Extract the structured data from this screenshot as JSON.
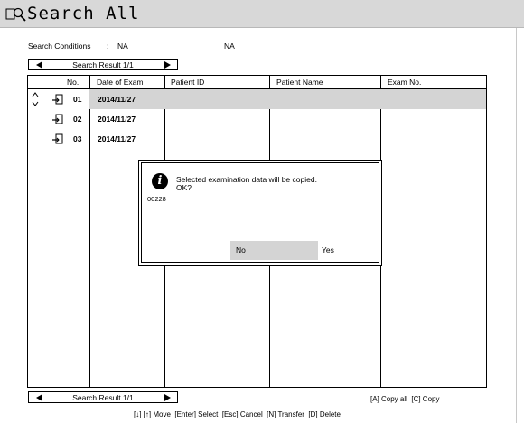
{
  "window": {
    "title": "Search All",
    "title_icon": "magnifier-person-icon"
  },
  "conditions": {
    "label": "Search Conditions",
    "colon": ":",
    "value1": "NA",
    "value2": "NA"
  },
  "pager_top": {
    "label": "Search Result 1/1"
  },
  "pager_bottom": {
    "label": "Search Result 1/1"
  },
  "table": {
    "headers": {
      "no": "No.",
      "date": "Date of Exam",
      "patient_id": "Patient ID",
      "patient_name": "Patient Name",
      "exam_no": "Exam No."
    },
    "rows": [
      {
        "no": "01",
        "date": "2014/11/27",
        "patient_id": "",
        "patient_name": "",
        "exam_no": "",
        "selected": true
      },
      {
        "no": "02",
        "date": "2014/11/27",
        "patient_id": "",
        "patient_name": "",
        "exam_no": "",
        "selected": false
      },
      {
        "no": "03",
        "date": "2014/11/27",
        "patient_id": "",
        "patient_name": "",
        "exam_no": "",
        "selected": false
      }
    ]
  },
  "dialog": {
    "icon": "info-icon",
    "code": "00228",
    "message_line1": "Selected examination data will be copied.",
    "message_line2": "OK?",
    "no_label": "No",
    "yes_label": "Yes",
    "focused": "No"
  },
  "footer": {
    "copy_hint": "[A] Copy all  [C] Copy",
    "key_hint": "[↓] [↑] Move  [Enter] Select  [Esc] Cancel  [N] Transfer  [D] Delete"
  },
  "colors": {
    "titlebar": "#d8d8d8",
    "selection": "#d4d4d4",
    "border": "#000000"
  }
}
